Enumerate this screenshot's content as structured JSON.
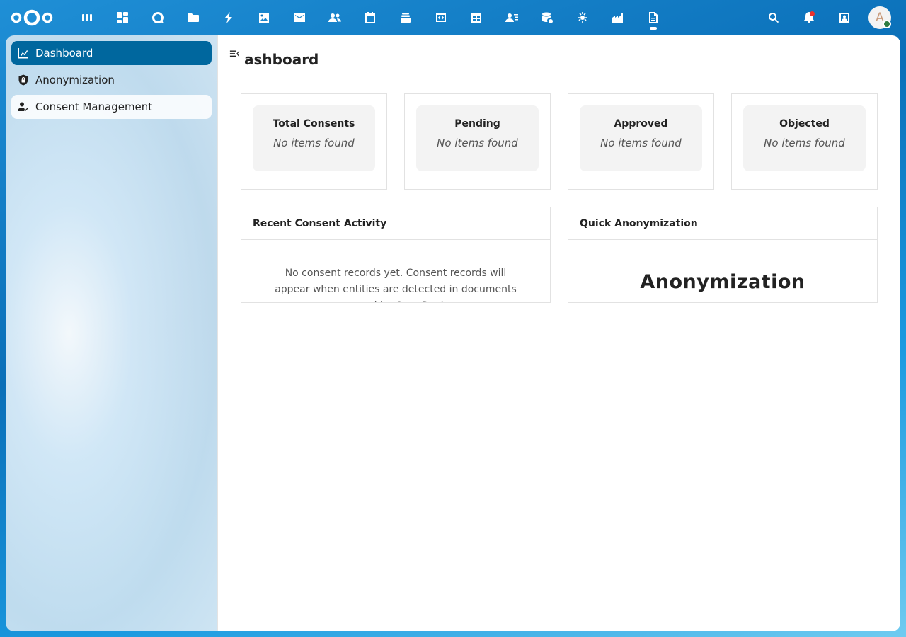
{
  "header": {
    "apps": [
      {
        "name": "all-apps",
        "icon": "grid-dots-icon"
      },
      {
        "name": "dashboard",
        "icon": "dashboard-icon"
      },
      {
        "name": "talk",
        "icon": "talk-icon"
      },
      {
        "name": "files",
        "icon": "folder-icon"
      },
      {
        "name": "activity",
        "icon": "lightning-icon"
      },
      {
        "name": "photos",
        "icon": "image-icon"
      },
      {
        "name": "mail",
        "icon": "mail-icon"
      },
      {
        "name": "contacts",
        "icon": "contacts-icon"
      },
      {
        "name": "calendar",
        "icon": "calendar-icon"
      },
      {
        "name": "deck",
        "icon": "stack-icon"
      },
      {
        "name": "code",
        "icon": "code-box-icon"
      },
      {
        "name": "tables",
        "icon": "table-icon"
      },
      {
        "name": "user-info",
        "icon": "user-list-icon"
      },
      {
        "name": "database-sync",
        "icon": "database-icon"
      },
      {
        "name": "puzzle",
        "icon": "puzzle-icon"
      },
      {
        "name": "factory",
        "icon": "factory-icon"
      },
      {
        "name": "document",
        "icon": "document-icon"
      }
    ],
    "avatar_letter": "A"
  },
  "sidebar": {
    "items": [
      {
        "label": "Dashboard",
        "icon": "chart-icon",
        "active": true
      },
      {
        "label": "Anonymization",
        "icon": "shield-lock-icon",
        "active": false
      },
      {
        "label": "Consent Management",
        "icon": "user-check-icon",
        "active": false
      }
    ]
  },
  "main": {
    "title": "ashboard",
    "stats": [
      {
        "label": "Total Consents",
        "value": "No items found"
      },
      {
        "label": "Pending",
        "value": "No items found"
      },
      {
        "label": "Approved",
        "value": "No items found"
      },
      {
        "label": "Objected",
        "value": "No items found"
      }
    ],
    "recent_activity": {
      "title": "Recent Consent Activity",
      "empty_text": "No consent records yet. Consent records will appear when entities are detected in documents processed by OpenRegister."
    },
    "quick_anonymization": {
      "title": "Quick Anonymization",
      "heading": "Anonymization"
    }
  },
  "colors": {
    "primary": "#00679e",
    "notification": "#e9322d",
    "status_online": "#2d7b41"
  }
}
